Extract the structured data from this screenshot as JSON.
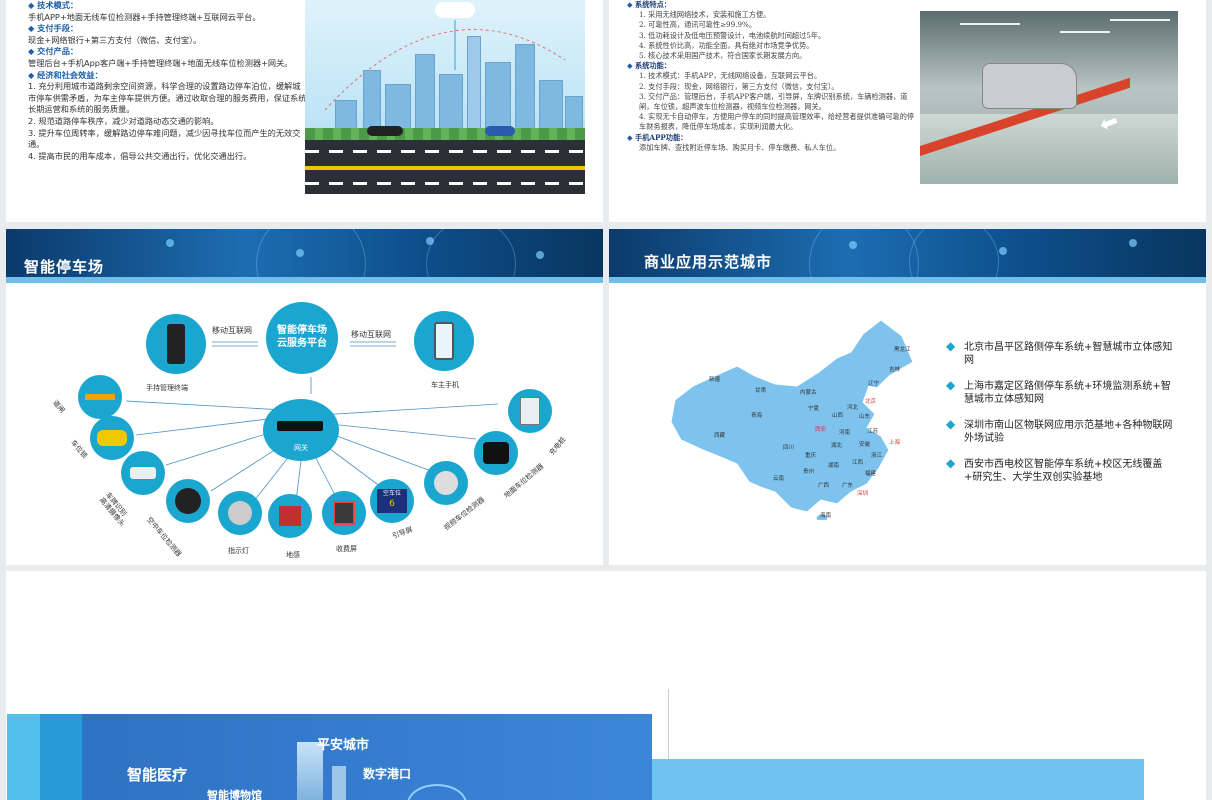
{
  "slide1": {
    "sections": [
      {
        "heading": "技术模式：",
        "body": "手机APP+地面无线车位检测器+手持管理终端+互联网云平台。"
      },
      {
        "heading": "支付手段：",
        "body": "现金+网络银行+第三方支付（微信、支付宝）。"
      },
      {
        "heading": "交付产品：",
        "body": "管理后台+手机App客户端+手持管理终端+地面无线车位检测器+网关。"
      },
      {
        "heading": "经济和社会效益：",
        "body": "1. 充分利用城市道路剩余空间资源，科学合理的设置路边停车泊位，缓解城市停车供需矛盾，为车主停车提供方便。通过收取合理的服务费用，保证系统长期运营和系统的服务质量。\n2. 规范道路停车秩序，减少对道路动态交通的影响。\n3. 提升车位周转率，缓解路边停车难问题，减少因寻找车位而产生的无效交通。\n4. 提高市民的用车成本，倡导公共交通出行，优化交通出行。"
      }
    ]
  },
  "slide2": {
    "heading1": "系统特点：",
    "features": [
      "1.  采用无线网络技术，安装和施工方便。",
      "2.  可靠性高，通讯可靠性≥99.9%。",
      "3.  低功耗设计及低电压预警设计，电池续航时间超过5年。",
      "4.  系统性价比高，功能全面，具有绝对市场竞争优势。",
      "5.  核心技术采用国产技术，符合国家长期发展方向。"
    ],
    "heading2": "系统功能：",
    "functions": [
      "1.  技术模式：手机APP，无线网络设备，互联网云平台。",
      "2.  支付手段：现金，网络银行，第三方支付（微信，支付宝）。",
      "3.  交付产品：管理后台，手机APP客户端，引导屏，车牌识别系统，车辆检测器，道闸，车位锁，超声波车位检测器，视频车位检测器，网关。",
      "4.  实现无卡自动停车，方便用户停车的同时提高管理效率，给经营者提供准确可靠的停车财务报表，降低停车场成本，实现利润最大化。"
    ],
    "heading3": "手机APP功能：",
    "app_functions": "添加车牌、查找附近停车场、购买月卡、停车缴费、私人车位。"
  },
  "slide3": {
    "title": "智能停车场",
    "cloud_label": "智能停车场\n云服务平台",
    "mobile_internet_left": "移动互联网",
    "mobile_internet_right": "移动互联网",
    "handheld_label": "手持管理终端",
    "phone_label": "车主手机",
    "gateway_label": "网关",
    "devices": [
      "道闸",
      "车位锁",
      "车牌识别\n高清摄像头",
      "空中车位检测器",
      "指示灯",
      "地感",
      "收费屏",
      "引导屏",
      "视频车位检测器",
      "地面车位检测器",
      "充电桩"
    ],
    "guide_screen_text": "空车位",
    "guide_screen_num": "6"
  },
  "slide4": {
    "title": "商业应用示范城市",
    "items": [
      "北京市昌平区路侧停车系统+智慧城市立体感知网",
      "上海市嘉定区路侧停车系统+环境监测系统+智慧城市立体感知网",
      "深圳市南山区物联网应用示范基地+各种物联网外场试验",
      "西安市西电校区智能停车系统+校区无线覆盖+研究生、大学生双创实验基地"
    ],
    "provinces": [
      "黑龙江",
      "吉林",
      "新疆",
      "甘肃",
      "内蒙古",
      "辽宁",
      "北京",
      "宁夏",
      "山西",
      "河北",
      "青海",
      "山东",
      "西藏",
      "西安",
      "河南",
      "江苏",
      "四川",
      "湖北",
      "安徽",
      "上海",
      "重庆",
      "浙江",
      "湖南",
      "江西",
      "贵州",
      "云南",
      "福建",
      "广西",
      "广东",
      "深圳",
      "海南"
    ],
    "map_color": "#7dc3ee"
  },
  "slide5": {
    "labels": [
      "平安城市",
      "智能医疗",
      "数字港口",
      "智能博物馆"
    ]
  }
}
